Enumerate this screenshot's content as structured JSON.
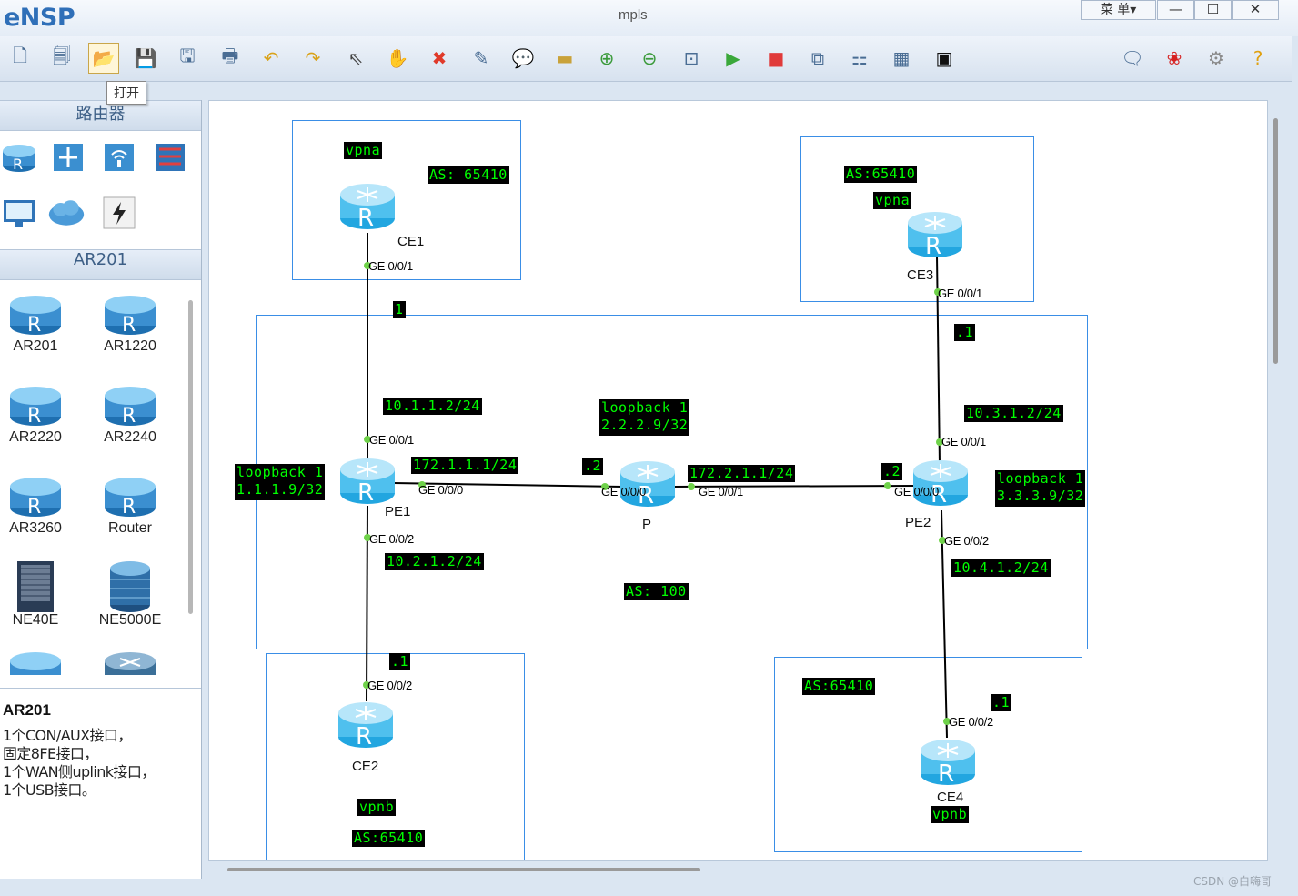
{
  "app": {
    "logo": "eNSP",
    "window_title": "mpls",
    "menu_label": "菜 单▾",
    "minimize": "—",
    "maximize": "☐",
    "close": "✕"
  },
  "toolbar": {
    "tooltip": "打开"
  },
  "left_panel": {
    "section_routers": "路由器",
    "section_model": "AR201",
    "devices": [
      "AR201",
      "AR1220",
      "AR2220",
      "AR2240",
      "AR3260",
      "Router",
      "NE40E",
      "NE5000E"
    ],
    "info_title": "AR201",
    "info_lines": [
      "1个CON/AUX接口，",
      "固定8FE接口，",
      "1个WAN侧uplink接口，",
      "1个USB接口。"
    ]
  },
  "topology": {
    "routers": {
      "ce1": "CE1",
      "ce2": "CE2",
      "ce3": "CE3",
      "ce4": "CE4",
      "pe1": "PE1",
      "pe2": "PE2",
      "p": "P"
    },
    "labels": {
      "ce1_vpn": "vpna",
      "ce1_as": "AS: 65410",
      "ce3_as": "AS:65410",
      "ce3_vpn": "vpna",
      "ce1_pe1_host": "1",
      "ce3_pe2_host": ".1",
      "pe1_up_ip": "10.1.1.2/24",
      "p_loopback_1": "loopback 1",
      "p_loopback_2": "2.2.2.9/32",
      "pe2_up_ip": "10.3.1.2/24",
      "pe1_loopback_1": "loopback 1",
      "pe1_loopback_2": "1.1.1.9/32",
      "pe1_p_ip": "172.1.1.1/24",
      "p_pe1_host": ".2",
      "p_pe2_ip": "172.2.1.1/24",
      "pe2_p_host": ".2",
      "pe2_loopback_1": "loopback 1",
      "pe2_loopback_2": "3.3.3.9/32",
      "pe1_down_ip": "10.2.1.2/24",
      "pe2_down_ip": "10.4.1.2/24",
      "core_as": "AS: 100",
      "ce2_host": ".1",
      "ce4_as": "AS:65410",
      "ce4_host": ".1",
      "ce2_vpn": "vpnb",
      "ce2_as": "AS:65410",
      "ce4_vpn": "vpnb"
    },
    "ports": {
      "ce1_port": "GE 0/0/1",
      "ce3_port": "GE 0/0/1",
      "pe1_up_port": "GE 0/0/1",
      "pe1_right_port": "GE 0/0/0",
      "p_left_port": "GE 0/0/0",
      "p_right_port": "GE 0/0/1",
      "pe2_up_port": "GE 0/0/1",
      "pe2_left_port": "GE 0/0/0",
      "pe1_down_port": "GE 0/0/2",
      "pe2_down_port": "GE 0/0/2",
      "ce2_port": "GE 0/0/2",
      "ce4_port": "GE 0/0/2"
    }
  },
  "watermark": "CSDN @白嗨哥",
  "colors": {
    "label_bg": "#000000",
    "label_fg": "#00ff00",
    "box_border": "#3a8ee6",
    "link": "#000000"
  }
}
